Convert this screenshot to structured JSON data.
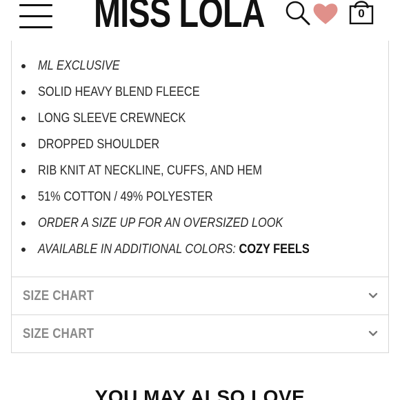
{
  "header": {
    "logo": "MISS LOLA",
    "bag_count": "0",
    "icons": [
      "menu-icon",
      "search-icon",
      "heart-icon",
      "shopping-bag-icon"
    ],
    "heart_color": "#e0908a"
  },
  "details": {
    "features": [
      {
        "text": "ML EXCLUSIVE",
        "italic": true
      },
      {
        "text": "SOLID HEAVY BLEND FLEECE",
        "italic": false
      },
      {
        "text": "LONG SLEEVE CREWNECK",
        "italic": false
      },
      {
        "text": "DROPPED SHOULDER",
        "italic": false
      },
      {
        "text": "RIB KNIT AT NECKLINE, CUFFS, AND HEM",
        "italic": false
      },
      {
        "text": "51% COTTON / 49% POLYESTER",
        "italic": false
      },
      {
        "text": "ORDER A SIZE UP FOR AN OVERSIZED LOOK",
        "italic": true
      },
      {
        "text": "AVAILABLE IN ADDITIONAL COLORS: ",
        "italic": true,
        "link": "COZY FEELS"
      }
    ]
  },
  "accordions": [
    {
      "label": "SIZE CHART"
    },
    {
      "label": "SIZE CHART"
    }
  ],
  "recommendations": {
    "heading": "YOU MAY ALSO LOVE"
  }
}
